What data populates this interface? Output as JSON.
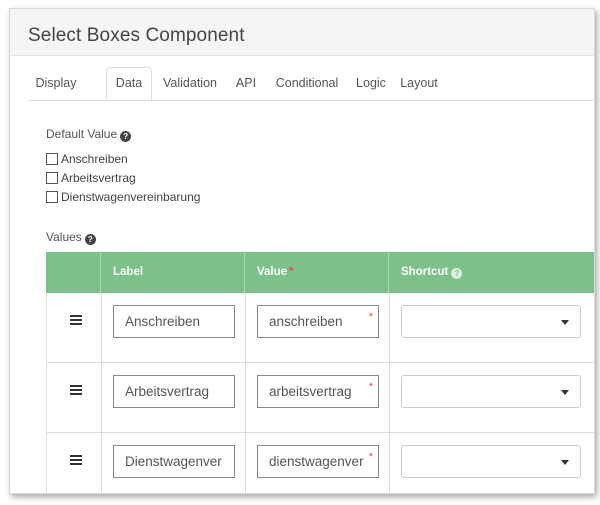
{
  "header": {
    "title": "Select Boxes Component"
  },
  "tabs": [
    {
      "label": "Display"
    },
    {
      "label": "Data",
      "active": true
    },
    {
      "label": "Validation"
    },
    {
      "label": "API"
    },
    {
      "label": "Conditional"
    },
    {
      "label": "Logic"
    },
    {
      "label": "Layout"
    }
  ],
  "default_value": {
    "label": "Default Value",
    "help_icon": "question-circle-icon",
    "options": [
      {
        "label": "Anschreiben",
        "checked": false
      },
      {
        "label": "Arbeitsvertrag",
        "checked": false
      },
      {
        "label": "Dienstwagenvereinbarung",
        "checked": false
      }
    ]
  },
  "values": {
    "label": "Values",
    "help_icon": "question-circle-icon",
    "columns": {
      "label": "Label",
      "value": "Value",
      "value_required_marker": "*",
      "shortcut": "Shortcut"
    },
    "rows": [
      {
        "label": "Anschreiben",
        "value": "anschreiben",
        "shortcut": ""
      },
      {
        "label": "Arbeitsvertrag",
        "value": "arbeitsvertrag",
        "shortcut": ""
      },
      {
        "label": "Dienstwagenver",
        "value": "dienstwagenver",
        "shortcut": ""
      }
    ],
    "required_marker": "*"
  },
  "colors": {
    "table_header": "#7cc08a",
    "required": "#d9534f"
  }
}
